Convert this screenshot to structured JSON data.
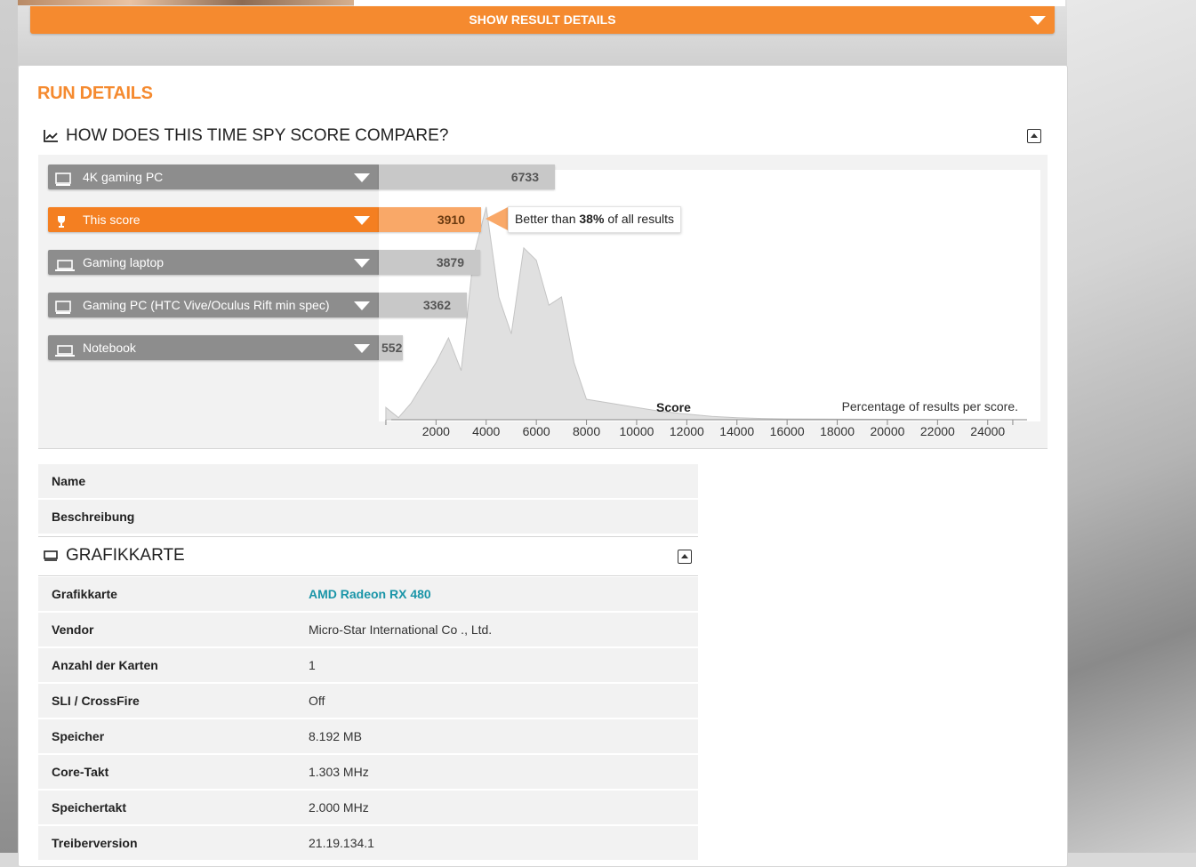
{
  "show_result_details": "SHOW RESULT DETAILS",
  "run_details_title": "RUN DETAILS",
  "compare": {
    "title": "HOW DOES THIS TIME SPY SCORE COMPARE?",
    "bars": [
      {
        "label": "4K gaming PC",
        "value": "6733",
        "active": false,
        "icon": "desktop-icon"
      },
      {
        "label": "This score",
        "value": "3910",
        "active": true,
        "icon": "trophy-icon"
      },
      {
        "label": "Gaming laptop",
        "value": "3879",
        "active": false,
        "icon": "laptop-icon"
      },
      {
        "label": "Gaming PC (HTC Vive/Oculus Rift min spec)",
        "value": "3362",
        "active": false,
        "icon": "desktop-icon"
      },
      {
        "label": "Notebook",
        "value": "552",
        "active": false,
        "icon": "laptop-icon"
      }
    ],
    "tooltip": {
      "prefix": "Better than",
      "percent": "38%",
      "suffix": "of all results"
    },
    "axis_label": "Score",
    "percent_caption": "Percentage of results per score."
  },
  "chart_data": {
    "type": "area",
    "xlabel": "Score",
    "ylabel": "",
    "caption": "Percentage of results per score.",
    "xlim": [
      0,
      25000
    ],
    "x_ticks": [
      "2000",
      "4000",
      "6000",
      "8000",
      "10000",
      "12000",
      "14000",
      "16000",
      "18000",
      "20000",
      "22000",
      "24000"
    ],
    "x": [
      0,
      500,
      1000,
      1500,
      2000,
      2500,
      3000,
      3500,
      4000,
      4500,
      5000,
      5500,
      6000,
      6500,
      7000,
      7500,
      8000,
      9000,
      10000,
      11000,
      12000,
      13000,
      14000,
      15000,
      16000,
      20000,
      24000
    ],
    "y": [
      3,
      0.5,
      4,
      9,
      14,
      20,
      12,
      40,
      52,
      30,
      21,
      42,
      39,
      28,
      30,
      14,
      5,
      4,
      3,
      2,
      1.4,
      0.8,
      0.5,
      0.3,
      0.2,
      0.1,
      0
    ],
    "markers": [
      {
        "name": "4K gaming PC",
        "x": 6733
      },
      {
        "name": "This score",
        "x": 3910
      },
      {
        "name": "Gaming laptop",
        "x": 3879
      },
      {
        "name": "Gaming PC (HTC Vive/Oculus Rift min spec)",
        "x": 3362
      },
      {
        "name": "Notebook",
        "x": 552
      }
    ]
  },
  "info_rows": [
    {
      "key": "Name",
      "value": ""
    },
    {
      "key": "Beschreibung",
      "value": ""
    }
  ],
  "gpu": {
    "title": "GRAFIKKARTE",
    "rows": [
      {
        "key": "Grafikkarte",
        "value": "AMD Radeon RX 480",
        "link": true
      },
      {
        "key": "Vendor",
        "value": "Micro-Star International Co ., Ltd.",
        "link": false
      },
      {
        "key": "Anzahl der Karten",
        "value": "1",
        "link": false
      },
      {
        "key": "SLI / CrossFire",
        "value": "Off",
        "link": false
      },
      {
        "key": "Speicher",
        "value": "8.192 MB",
        "link": false
      },
      {
        "key": "Core-Takt",
        "value": "1.303 MHz",
        "link": false
      },
      {
        "key": "Speichertakt",
        "value": "2.000 MHz",
        "link": false
      },
      {
        "key": "Treiberversion",
        "value": "21.19.134.1",
        "link": false
      }
    ]
  },
  "colors": {
    "accent": "#f58a2f",
    "link": "#1a95a8",
    "bar_grey": "#8d8d8d"
  }
}
